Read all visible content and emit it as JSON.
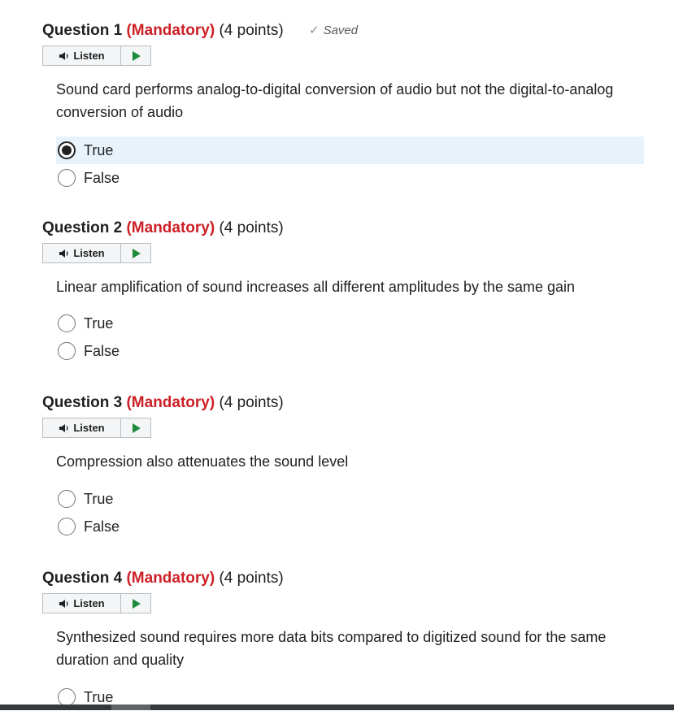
{
  "saved_status": {
    "text": "Saved",
    "icon": "checkmark-icon"
  },
  "listen": {
    "label": "Listen",
    "icon": "speaker-icon",
    "play_icon": "play-icon",
    "play_color": "#1e8a3c"
  },
  "colors": {
    "mandatory": "#cd2026",
    "selected_bg": "#e8f2fb"
  },
  "questions": [
    {
      "number": "Question 1",
      "mandatory": "(Mandatory)",
      "points": "(4 points)",
      "text": "Sound card performs analog-to-digital conversion of audio but not the digital-to-analog conversion of audio",
      "options": [
        {
          "label": "True",
          "selected": true
        },
        {
          "label": "False",
          "selected": false
        }
      ]
    },
    {
      "number": "Question 2",
      "mandatory": "(Mandatory)",
      "points": "(4 points)",
      "text": "Linear amplification of sound increases all different amplitudes by the same gain",
      "options": [
        {
          "label": "True",
          "selected": false
        },
        {
          "label": "False",
          "selected": false
        }
      ]
    },
    {
      "number": "Question 3",
      "mandatory": "(Mandatory)",
      "points": "(4 points)",
      "text": "Compression also attenuates the sound level",
      "options": [
        {
          "label": "True",
          "selected": false
        },
        {
          "label": "False",
          "selected": false
        }
      ]
    },
    {
      "number": "Question 4",
      "mandatory": "(Mandatory)",
      "points": "(4 points)",
      "text": "Synthesized sound requires more data bits compared to digitized sound for the same duration and quality",
      "options": [
        {
          "label": "True",
          "selected": false
        }
      ]
    }
  ]
}
